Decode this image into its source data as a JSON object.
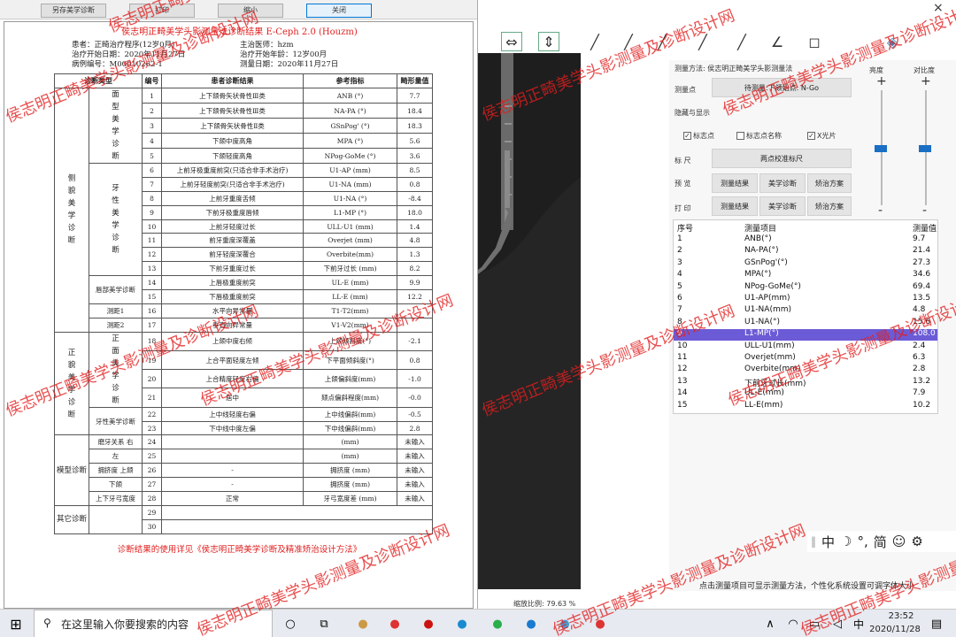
{
  "left_window": {
    "buttons": [
      "另存美学诊断",
      "打印",
      "缩小",
      "关闭"
    ]
  },
  "report": {
    "title": "侯志明正畸美学头影测量法诊断结果 E-Ceph 2.0 (Houzm)",
    "patient": "患者：正畸治疗程序(12岁0月)",
    "doctor": "主治医师：hzm",
    "start_date": "治疗开始日期：2020年11月27日",
    "start_age": "治疗开始年龄：12岁00月",
    "case_no": "病例编号：M00010262-1",
    "measure_date": "测量日期：2020年11月27日",
    "headers": [
      "诊断类型",
      "编号",
      "患者诊断结果",
      "参考指标",
      "畸形量值"
    ],
    "note": "诊断结果的使用详见《侯志明正畸美学诊断及精准矫治设计方法》"
  },
  "rows": [
    {
      "no": "1",
      "result": "上下颌骨矢状骨性Ⅲ类",
      "ref": "ANB (°)",
      "val": "7.7"
    },
    {
      "no": "2",
      "result": "上下颌骨矢状骨性Ⅲ类",
      "ref": "NA-PA (°)",
      "val": "18.4"
    },
    {
      "no": "3",
      "result": "上下颌骨矢状骨性Ⅱ类",
      "ref": "GSnPog' (°)",
      "val": "18.3"
    },
    {
      "no": "4",
      "result": "下颌中度高角",
      "ref": "MPA (°)",
      "val": "5.6"
    },
    {
      "no": "5",
      "result": "下颌轻度高角",
      "ref": "NPog-GoMe (°)",
      "val": "3.6"
    },
    {
      "no": "6",
      "result": "上前牙极重度前突(只适合非手术治疗)",
      "ref": "U1-AP (mm)",
      "val": "8.5"
    },
    {
      "no": "7",
      "result": "上前牙轻度前突(只适合非手术治疗)",
      "ref": "U1-NA (mm)",
      "val": "0.8"
    },
    {
      "no": "8",
      "result": "上前牙重度舌倾",
      "ref": "U1-NA (°)",
      "val": "-8.4"
    },
    {
      "no": "9",
      "result": "下前牙极重度唇倾",
      "ref": "L1-MP (°)",
      "val": "18.0"
    },
    {
      "no": "10",
      "result": "上前牙轻度过长",
      "ref": "ULL-U1 (mm)",
      "val": "1.4"
    },
    {
      "no": "11",
      "result": "前牙重度深覆盖",
      "ref": "Overjet (mm)",
      "val": "4.8"
    },
    {
      "no": "12",
      "result": "前牙轻度深覆合",
      "ref": "Overbite(mm)",
      "val": "1.3"
    },
    {
      "no": "13",
      "result": "下前牙重度过长",
      "ref": "下前牙过长 (mm)",
      "val": "8.2"
    },
    {
      "no": "14",
      "result": "上唇极重度前突",
      "ref": "UL-E (mm)",
      "val": "9.9"
    },
    {
      "no": "15",
      "result": "下唇极重度前突",
      "ref": "LL-E (mm)",
      "val": "12.2"
    },
    {
      "no": "16",
      "result": "水平向异常量",
      "ref": "T1-T2(mm)",
      "val": ""
    },
    {
      "no": "17",
      "result": "垂直向异常量",
      "ref": "V1-V2(mm)",
      "val": ""
    },
    {
      "no": "18",
      "result": "上颌中度右倾",
      "ref": "上颌倾斜度(°)",
      "val": "-2.1"
    },
    {
      "no": "19",
      "result": "上合平面轻度左倾",
      "ref": "下平面倾斜度(°)",
      "val": "0.8"
    },
    {
      "no": "20",
      "result": "上合精度轻度右偏",
      "ref": "上颌偏斜度(mm)",
      "val": "-1.0"
    },
    {
      "no": "21",
      "result": "居中",
      "ref": "颏点偏斜程度(mm)",
      "val": "-0.0"
    },
    {
      "no": "22",
      "result": "上中线轻度右偏",
      "ref": "上中线偏斜(mm)",
      "val": "-0.5"
    },
    {
      "no": "23",
      "result": "下中线中度左偏",
      "ref": "下中线偏斜(mm)",
      "val": "2.8"
    },
    {
      "no": "24",
      "result": "",
      "ref": "(mm)",
      "val": "未输入"
    },
    {
      "no": "25",
      "result": "",
      "ref": "(mm)",
      "val": "未输入"
    },
    {
      "no": "26",
      "result": "-",
      "ref": "拥挤度 (mm)",
      "val": "未输入"
    },
    {
      "no": "27",
      "result": "-",
      "ref": "拥挤度 (mm)",
      "val": "未输入"
    },
    {
      "no": "28",
      "result": "正常",
      "ref": "牙弓宽度差 (mm)",
      "val": "未输入"
    },
    {
      "no": "29",
      "result": "",
      "ref": "",
      "val": ""
    },
    {
      "no": "30",
      "result": "",
      "ref": "",
      "val": ""
    }
  ],
  "cats": {
    "c1": "侧貌美学诊断",
    "c1a": "面型美学诊断",
    "c1b": "牙性美学诊断",
    "c1c": "唇部美学诊断",
    "c1d": "测距1",
    "c1e": "测距2",
    "c2": "正貌美学诊断",
    "c2a": "正面美学诊断",
    "c2b": "牙性美学诊断",
    "c3": "模型诊断",
    "c3a": "磨牙关系",
    "c3a1": "右",
    "c3a2": "左",
    "c3b": "拥挤度",
    "c3b1": "上颌",
    "c3b2": "下颌",
    "c3c": "上下牙弓宽度",
    "c4": "其它诊断"
  },
  "panel": {
    "method": "测量方法: 侯志明正畸美学头影测量法",
    "brightness": "亮度",
    "contrast": "对比度",
    "point_label": "测量点",
    "point_value": "待测量:下颌始点: N-Go",
    "hide_label": "隐藏与显示",
    "chk1": "标志点",
    "chk2": "标志点名称",
    "chk3": "X光片",
    "ruler_label": "标  尺",
    "ruler_btn": "两点校准标尺",
    "preview_label": "预  览",
    "print_label": "打  印",
    "btn_result": "测量结果",
    "btn_aes": "美学诊断",
    "btn_plan": "矫治方案",
    "plus": "+",
    "minus": "-"
  },
  "mlist": {
    "headers": [
      "序号",
      "测量项目",
      "测量值"
    ],
    "rows": [
      [
        "1",
        "ANB(°)",
        "9.7"
      ],
      [
        "2",
        "NA-PA(°)",
        "21.4"
      ],
      [
        "3",
        "GSnPog'(°)",
        "27.3"
      ],
      [
        "4",
        "MPA(°)",
        "34.6"
      ],
      [
        "5",
        "NPog-GoMe(°)",
        "69.4"
      ],
      [
        "6",
        "U1-AP(mm)",
        "13.5"
      ],
      [
        "7",
        "U1-NA(mm)",
        "4.8"
      ],
      [
        "8",
        "U1-NA(°)",
        "15.6"
      ],
      [
        "9",
        "L1-MP(°)",
        "108.0"
      ],
      [
        "10",
        "ULL-U1(mm)",
        "2.4"
      ],
      [
        "11",
        "Overjet(mm)",
        "6.3"
      ],
      [
        "12",
        "Overbite(mm)",
        "2.8"
      ],
      [
        "13",
        "下前牙过长(mm)",
        "13.2"
      ],
      [
        "14",
        "UL-E(mm)",
        "7.9"
      ],
      [
        "15",
        "LL-E(mm)",
        "10.2"
      ]
    ],
    "selected": 8
  },
  "ime": [
    "中",
    "☽",
    "°,",
    "简",
    "☺",
    "⚙"
  ],
  "hint": "点击测量项目可显示测量方法，个性化系统设置可调字体大小",
  "scale": "缩放比例: 79.63 %",
  "taskbar": {
    "search": "在这里输入你要搜索的内容",
    "ime": "中",
    "time": "23:52",
    "date": "2020/11/28"
  },
  "watermark": "侯志明正畸美学头影测量及诊断设计网",
  "top_close": "×"
}
